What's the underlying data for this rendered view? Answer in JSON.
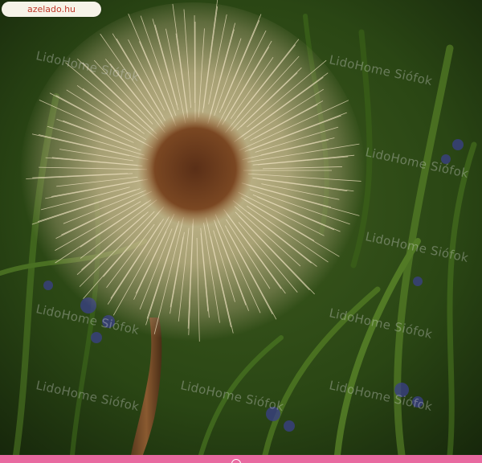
{
  "site_badge": {
    "text": "azelado.hu"
  },
  "watermark": {
    "text": "LidoHome Siófok"
  },
  "photo": {
    "subject": "dandelion-seed-head",
    "accent": "#e86aa0"
  }
}
